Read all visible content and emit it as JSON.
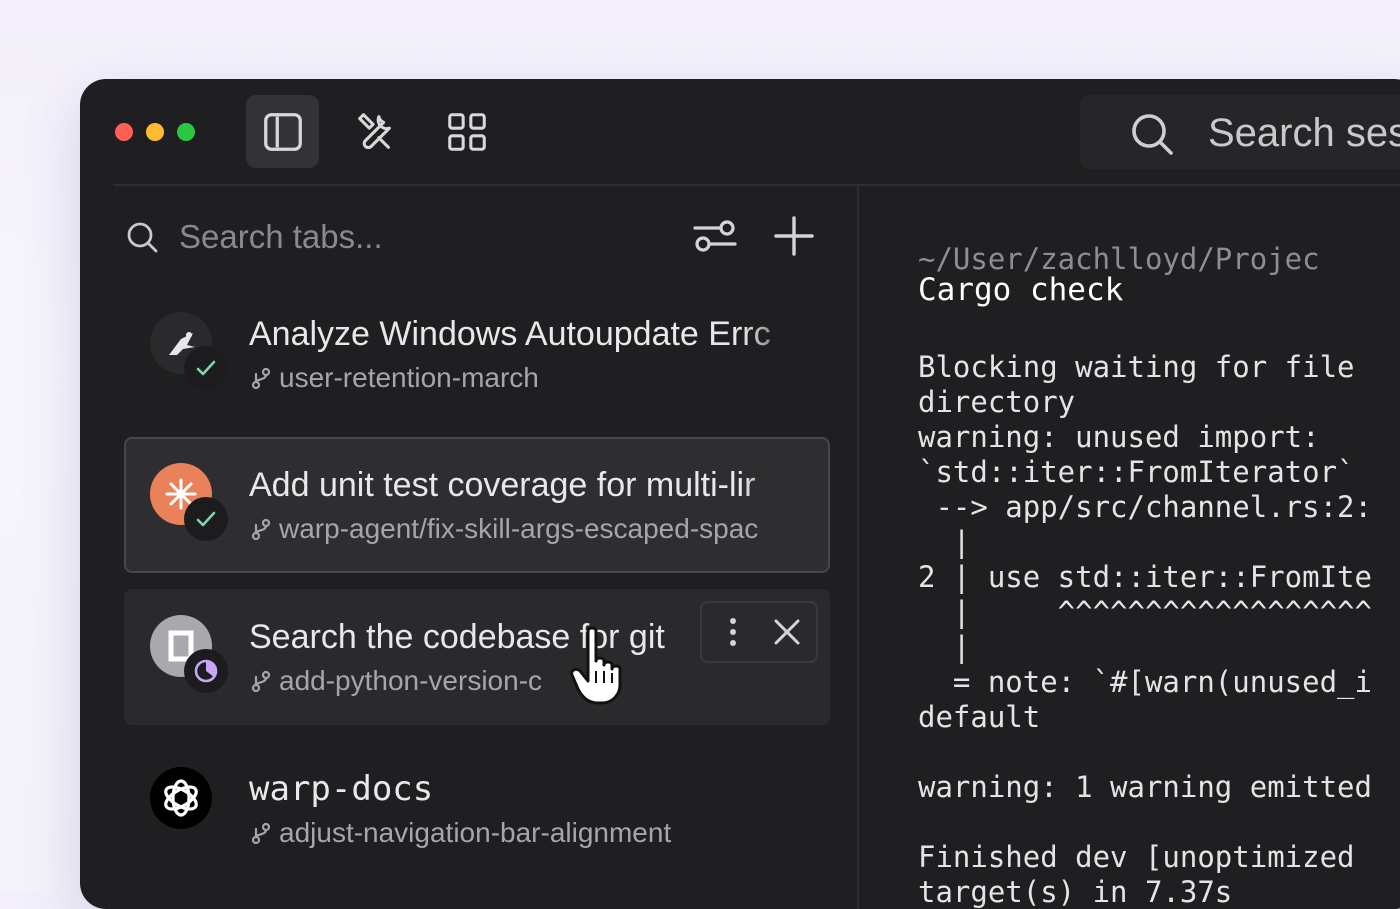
{
  "toolbar": {
    "tools": [
      {
        "name": "sidebar-toggle",
        "icon": "sidebar-icon",
        "active": true
      },
      {
        "name": "tools",
        "icon": "tools-icon",
        "active": false
      },
      {
        "name": "apps",
        "icon": "grid-icon",
        "active": false
      }
    ],
    "search_placeholder": "Search ses"
  },
  "sidebar": {
    "search_placeholder": "Search tabs...",
    "tabs": [
      {
        "title": "Analyze Windows Autoupdate Errc",
        "branch": "user-retention-march",
        "avatar_icon": "bug-icon",
        "avatar_color": "#2a2a2c",
        "status_icon": "check-icon",
        "state": "normal"
      },
      {
        "title": "Add unit test coverage for multi-lir",
        "branch": "warp-agent/fix-skill-args-escaped-spac",
        "avatar_icon": "sparkle-icon",
        "avatar_color": "#e9825a",
        "status_icon": "check-icon",
        "state": "selected"
      },
      {
        "title": "Search the codebase for git",
        "branch": "add-python-version-c",
        "avatar_icon": "square-icon",
        "avatar_color": "#a9a9ad",
        "status_icon": "progress-icon",
        "state": "hovered"
      },
      {
        "title": "warp-docs",
        "branch": "adjust-navigation-bar-alignment",
        "avatar_icon": "openai-icon",
        "avatar_color": "#000000",
        "status_icon": "",
        "state": "normal"
      }
    ]
  },
  "terminal": {
    "path": "~/User/zachlloyd/Projec",
    "command": "Cargo check",
    "lines": [
      "Blocking waiting for file",
      "directory",
      "warning: unused import:",
      "`std::iter::FromIterator`",
      " --> app/src/channel.rs:2:",
      "  |",
      "2 | use std::iter::FromIte",
      "  |     ^^^^^^^^^^^^^^^^^^",
      "  |",
      "  = note: `#[warn(unused_i",
      "default",
      "",
      "warning: 1 warning emitted",
      "",
      "Finished dev [unoptimized",
      "target(s) in 7.37s"
    ]
  }
}
